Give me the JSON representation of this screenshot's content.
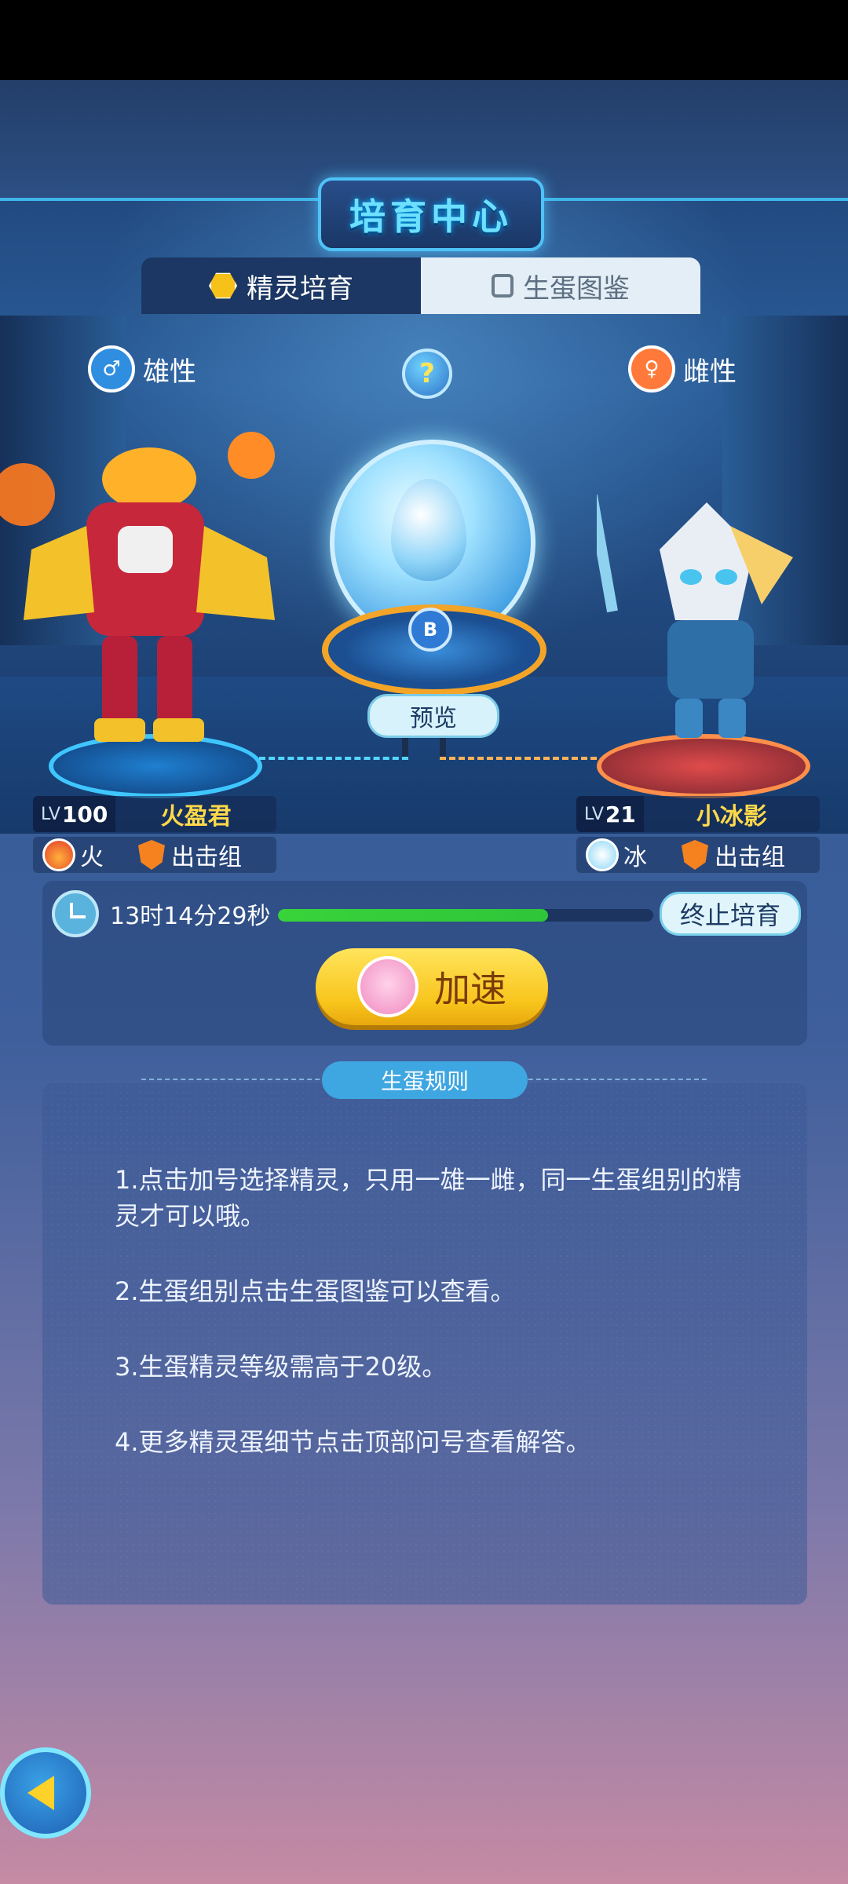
{
  "header": {
    "title": "培育中心"
  },
  "tabs": [
    {
      "label": "精灵培育",
      "active": true
    },
    {
      "label": "生蛋图鉴",
      "active": false
    }
  ],
  "help": {
    "label": "?"
  },
  "male": {
    "gender_label": "雄性",
    "level_tag": "LV",
    "level": "100",
    "name": "火盈君",
    "element": "火",
    "group": "出击组"
  },
  "female": {
    "gender_label": "雌性",
    "level_tag": "LV",
    "level": "21",
    "name": "小冰影",
    "element": "冰",
    "group": "出击组"
  },
  "incubator": {
    "badge": "B",
    "preview_label": "预览"
  },
  "breeding": {
    "timer": "13时14分29秒",
    "progress": 0.72,
    "stop_label": "终止培育",
    "speed_label": "加速"
  },
  "rules": {
    "title": "生蛋规则",
    "items": [
      "1.点击加号选择精灵，只用一雄一雌，同一生蛋组别的精灵才可以哦。",
      "2.生蛋组别点击生蛋图鉴可以查看。",
      "3.生蛋精灵等级需高于20级。",
      "4.更多精灵蛋细节点击顶部问号查看解答。"
    ]
  },
  "colors": {
    "accent_blue": "#4fc3f7",
    "speed_yellow": "#f8c51c",
    "name_yellow": "#ffd94a",
    "progress_green": "#39d33b"
  }
}
